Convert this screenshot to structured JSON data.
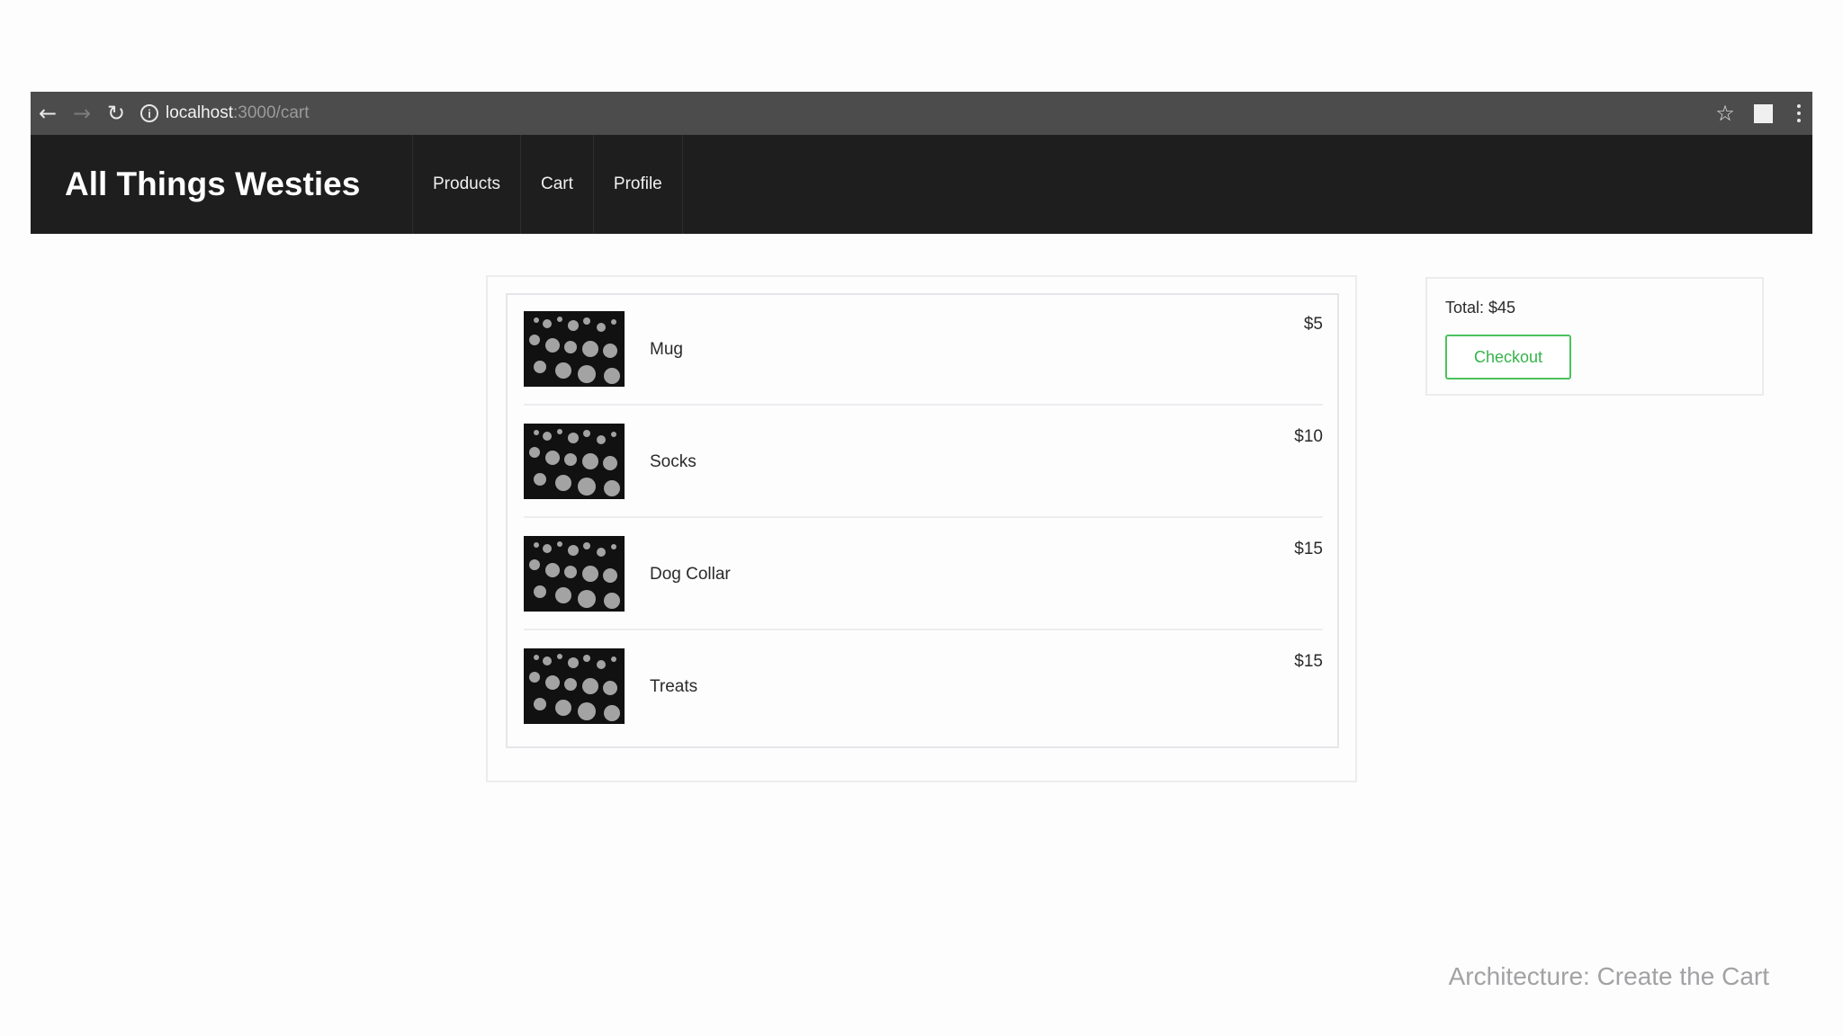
{
  "browser": {
    "url_host": "localhost",
    "url_rest": ":3000/cart",
    "icons": [
      "back-arrow-icon",
      "forward-arrow-icon",
      "reload-icon",
      "info-icon",
      "star-icon",
      "extension-icon",
      "menu-icon"
    ]
  },
  "navbar": {
    "brand": "All Things Westies",
    "links": [
      {
        "label": "Products"
      },
      {
        "label": "Cart"
      },
      {
        "label": "Profile"
      }
    ]
  },
  "cart": {
    "items": [
      {
        "name": "Mug",
        "price": "$5"
      },
      {
        "name": "Socks",
        "price": "$10"
      },
      {
        "name": "Dog Collar",
        "price": "$15"
      },
      {
        "name": "Treats",
        "price": "$15"
      }
    ]
  },
  "summary": {
    "total": "Total: $45",
    "checkout_label": "Checkout"
  },
  "caption": "Architecture: Create the Cart",
  "colors": {
    "chrome": "#4c4c4c",
    "navbar": "#1e1e1e",
    "checkout_accent": "#35b34a"
  }
}
